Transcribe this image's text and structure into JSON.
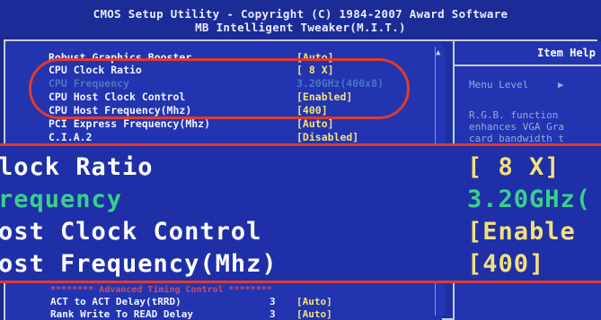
{
  "header": {
    "line1": "CMOS Setup Utility - Copyright (C) 1984-2007 Award Software",
    "line2": "MB Intelligent Tweaker(M.I.T.)"
  },
  "settings": [
    {
      "label": "Robust Graphics Booster",
      "value": "[Auto]"
    },
    {
      "label": "CPU Clock Ratio",
      "value": "[ 8 X]"
    },
    {
      "label": "CPU Frequency",
      "value": "3.20GHz(400x8)"
    },
    {
      "label": "CPU Host Clock Control",
      "value": "[Enabled]"
    },
    {
      "label": "CPU Host Frequency(Mhz)",
      "value": "[400]"
    },
    {
      "label": "PCI Express Frequency(Mhz)",
      "value": "[Auto]"
    },
    {
      "label": "C.I.A.2",
      "value": "[Disabled]"
    }
  ],
  "zoom": [
    {
      "label": "lock Ratio",
      "value": "[ 8 X]"
    },
    {
      "label": "requency",
      "value": "3.20GHz("
    },
    {
      "label": "ost Clock Control",
      "value": "[Enable"
    },
    {
      "label": "ost Frequency(Mhz)",
      "value": "[400]"
    }
  ],
  "advanced_separator": "******** Advanced Timing Control ********",
  "timing": [
    {
      "label": "ACT to ACT Delay(tRRD)",
      "num": "3",
      "value": "[Auto]"
    },
    {
      "label": "Rank Write To READ Delay",
      "num": "3",
      "value": "[Auto]"
    }
  ],
  "help": {
    "title": "Item Help",
    "menu_level": "Menu Level",
    "menu_arrow": "▶",
    "text": "R.G.B. function\nenhances VGA Gra\ncard bandwidth t"
  },
  "colors": {
    "background": "#2234b0",
    "highlight_oval": "#e23a2a",
    "value_yellow": "#f3e07a",
    "dimmed_item": "#4f73c8"
  }
}
